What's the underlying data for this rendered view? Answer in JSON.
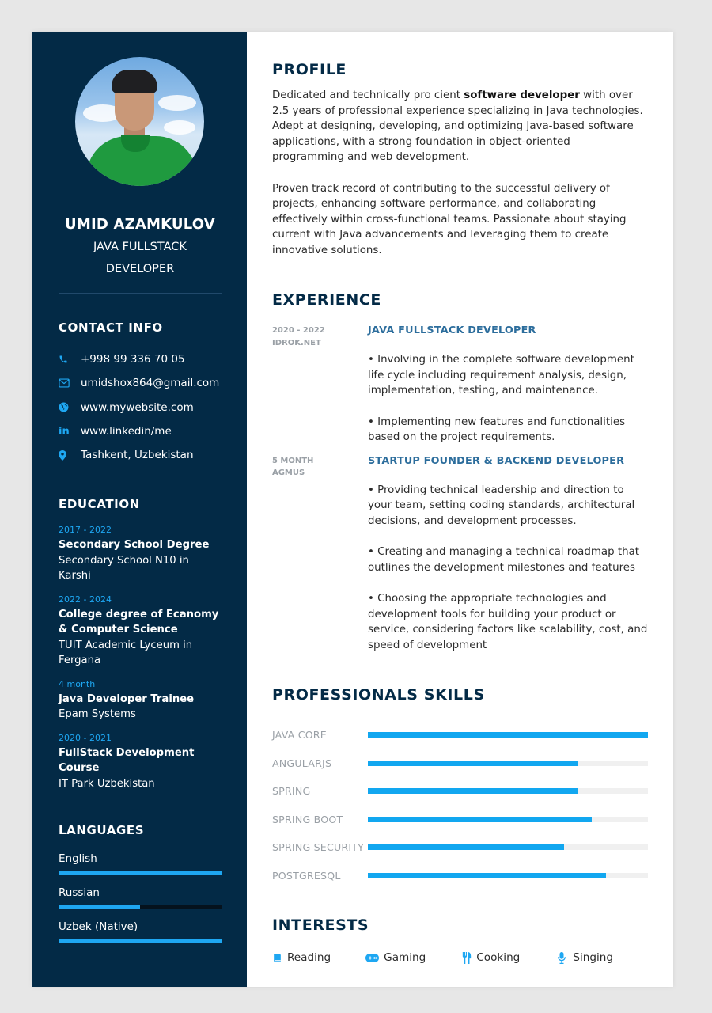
{
  "sidebar": {
    "name": "UMID AZAMKULOV",
    "title_line1": "JAVA FULLSTACK",
    "title_line2": "DEVELOPER",
    "contact_heading": "CONTACT INFO",
    "contact": [
      {
        "icon": "phone-icon",
        "text": "+998 99 336 70 05"
      },
      {
        "icon": "email-icon",
        "text": "umidshox864@gmail.com"
      },
      {
        "icon": "globe-icon",
        "text": "www.mywebsite.com"
      },
      {
        "icon": "linkedin-icon",
        "text": "www.linkedin/me"
      },
      {
        "icon": "location-pin-icon",
        "text": "Tashkent, Uzbekistan"
      }
    ],
    "education_heading": "EDUCATION",
    "education": [
      {
        "years": "2017 - 2022",
        "degree": "Secondary School Degree",
        "school": "Secondary School N10 in Karshi"
      },
      {
        "years": "2022 - 2024",
        "degree": "College degree of Ecanomy & Computer Science",
        "school": "TUIT Academic Lyceum in Fergana"
      },
      {
        "years": "4 month",
        "degree": "Java Developer Trainee",
        "school": "Epam Systems"
      },
      {
        "years": "2020 - 2021",
        "degree": "FullStack Development Course",
        "school": "IT Park Uzbekistan"
      }
    ],
    "languages_heading": "LANGUAGES",
    "languages": [
      {
        "name": "English",
        "level": 1.0
      },
      {
        "name": "Russian",
        "level": 0.5
      },
      {
        "name": "Uzbek (Native)",
        "level": 1.0
      }
    ]
  },
  "main": {
    "profile_heading": "PROFILE",
    "profile_p1_pre": "Dedicated and technically pro cient ",
    "profile_p1_bold": "software developer",
    "profile_p1_post": " with over 2.5 years of professional experience specializing in Java technologies. Adept at designing, developing, and optimizing Java-based software applications, with a strong foundation in object-oriented programming and web development.",
    "profile_p2": "Proven track record of contributing to the successful delivery of projects, enhancing software performance, and collaborating effectively within cross-functional teams. Passionate about staying current with Java advancements and leveraging them to create innovative solutions.",
    "experience_heading": "EXPERIENCE",
    "experience": [
      {
        "period": "2020 - 2022",
        "company": "IDROK.NET",
        "role": "JAVA FULLSTACK DEVELOPER",
        "points": [
          "• Involving in the complete software development life cycle including requirement analysis, design, implementation, testing, and maintenance.",
          "• Implementing new features and functionalities based on the project requirements."
        ]
      },
      {
        "period": "5 MONTH",
        "company": "AGMUS",
        "role": "STARTUP FOUNDER & BACKEND DEVELOPER",
        "points": [
          "• Providing technical leadership and direction to your team, setting coding standards, architectural decisions, and development processes.",
          "• Creating and managing a technical roadmap that outlines the development milestones and features",
          "• Choosing the appropriate technologies and development tools for building your product or service, considering factors like scalability, cost, and speed of development"
        ]
      }
    ],
    "skills_heading": "PROFESSIONALS SKILLS",
    "skills": [
      {
        "name": "JAVA CORE",
        "level": 1.0
      },
      {
        "name": "ANGULARJS",
        "level": 0.75
      },
      {
        "name": "SPRING",
        "level": 0.75
      },
      {
        "name": "SPRING BOOT",
        "level": 0.8
      },
      {
        "name": "SPRING SECURITY",
        "level": 0.7
      },
      {
        "name": "POSTGRESQL",
        "level": 0.85
      }
    ],
    "interests_heading": "INTERESTS",
    "interests": [
      {
        "icon": "book-icon",
        "label": "Reading"
      },
      {
        "icon": "gamepad-icon",
        "label": "Gaming"
      },
      {
        "icon": "utensils-icon",
        "label": "Cooking"
      },
      {
        "icon": "microphone-icon",
        "label": "Singing"
      }
    ],
    "colors": {
      "sidebar": "#032a46",
      "accent": "#1ea7f2",
      "heading": "#032a46",
      "role": "#2c6d9c"
    }
  }
}
